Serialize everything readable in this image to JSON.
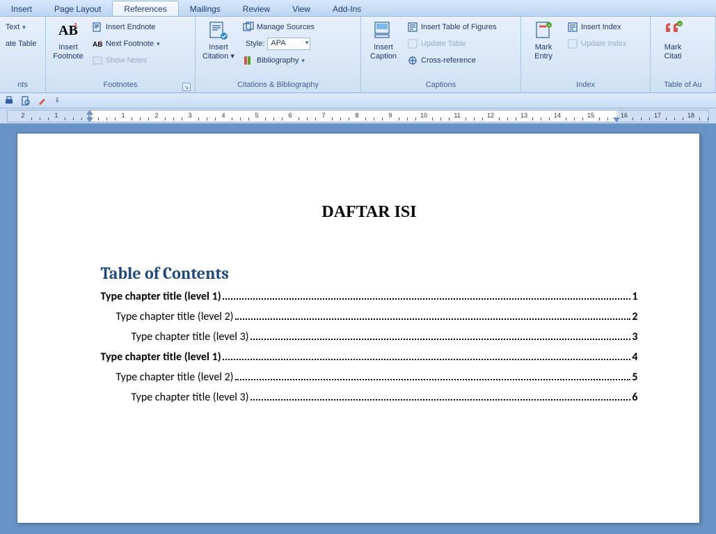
{
  "tabs": {
    "insert": "Insert",
    "page_layout": "Page Layout",
    "references": "References",
    "mailings": "Mailings",
    "review": "Review",
    "view": "View",
    "add_ins": "Add-Ins"
  },
  "ribbon": {
    "toc": {
      "text_dd": "Text",
      "update_table": "ate Table",
      "group_label": "nts"
    },
    "footnotes": {
      "big": "Insert\nFootnote",
      "insert_endnote": "Insert Endnote",
      "next_footnote": "Next Footnote",
      "show_notes": "Show Notes",
      "group_label": "Footnotes"
    },
    "citations": {
      "big": "Insert\nCitation",
      "manage_sources": "Manage Sources",
      "style_label": "Style:",
      "style_value": "APA",
      "bibliography": "Bibliography",
      "group_label": "Citations & Bibliography"
    },
    "captions": {
      "big": "Insert\nCaption",
      "insert_tof": "Insert Table of Figures",
      "update_table": "Update Table",
      "cross_ref": "Cross-reference",
      "group_label": "Captions"
    },
    "index": {
      "big": "Mark\nEntry",
      "insert_index": "Insert Index",
      "update_index": "Update Index",
      "group_label": "Index"
    },
    "toa": {
      "big": "Mark\nCitati",
      "group_label": "Table of Au"
    }
  },
  "document": {
    "main_title": "DAFTAR ISI",
    "toc_heading": "Table of Contents",
    "entries": [
      {
        "level": 1,
        "text": "Type chapter title (level 1)",
        "page": "1"
      },
      {
        "level": 2,
        "text": "Type chapter title (level 2)",
        "page": "2"
      },
      {
        "level": 3,
        "text": "Type chapter title (level 3)",
        "page": "3"
      },
      {
        "level": 1,
        "text": "Type chapter title (level 1)",
        "page": "4"
      },
      {
        "level": 2,
        "text": "Type chapter title (level 2)",
        "page": "5"
      },
      {
        "level": 3,
        "text": "Type chapter title (level 3)",
        "page": "6"
      }
    ]
  }
}
